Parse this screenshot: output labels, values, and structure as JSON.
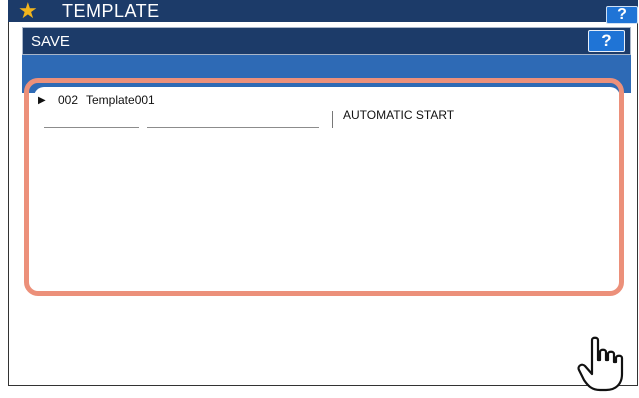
{
  "background_header": {
    "title": "TEMPLATE",
    "help_label": "?",
    "icon": "star-icon"
  },
  "dialog": {
    "title": "SAVE",
    "help_label": "?"
  },
  "template_info": {
    "pointer_glyph": "▶",
    "number": "002",
    "name": "Template001",
    "automatic_start_label": "AUTOMATIC START"
  },
  "cursor": {
    "icon": "hand-pointer-icon"
  },
  "colors": {
    "titlebar": "#1c3b69",
    "band": "#2e6ab5",
    "help_button": "#1f74d6",
    "highlight": "#ec907a",
    "star": "#f1b41c"
  }
}
